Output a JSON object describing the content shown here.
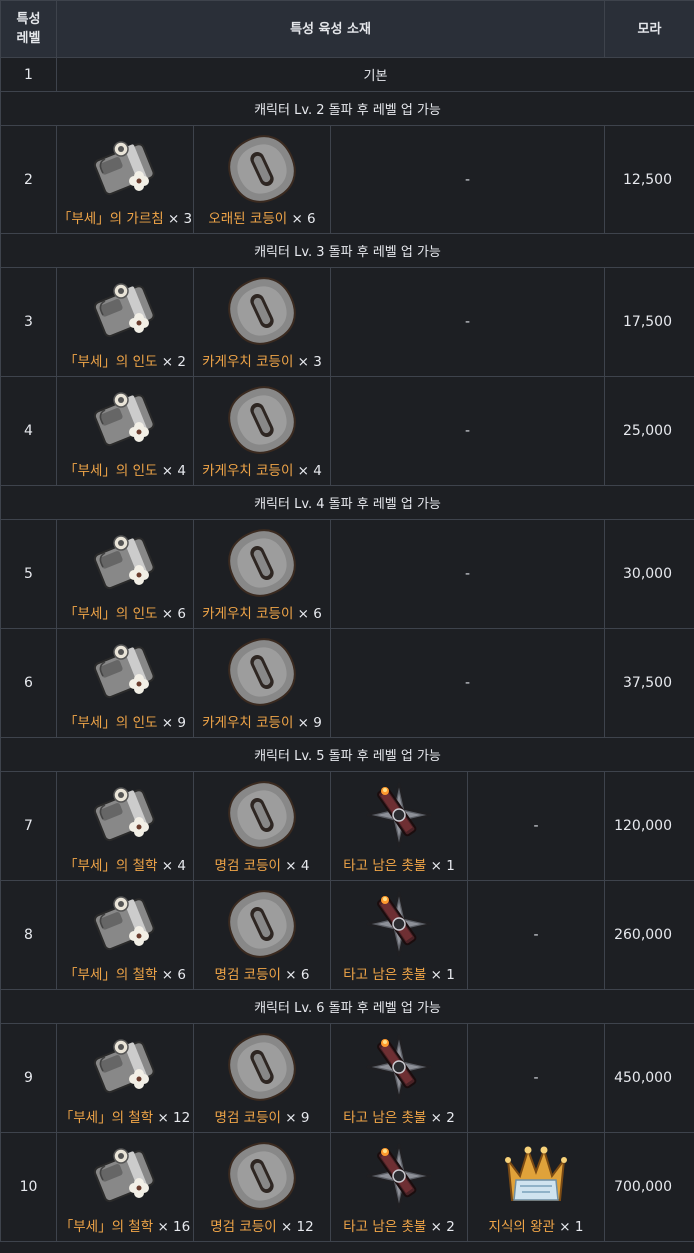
{
  "header": {
    "level_line1": "특성",
    "level_line2": "레벨",
    "materials": "특성 육성 소재",
    "mora": "모라"
  },
  "base": {
    "level": "1",
    "label": "기본"
  },
  "separators": [
    "캐릭터 Lv. 2 돌파 후 레벨 업 가능",
    "캐릭터 Lv. 3 돌파 후 레벨 업 가능",
    "캐릭터 Lv. 4 돌파 후 레벨 업 가능",
    "캐릭터 Lv. 5 돌파 후 레벨 업 가능",
    "캐릭터 Lv. 6 돌파 후 레벨 업 가능"
  ],
  "rows": [
    {
      "level": "2",
      "mora": "12,500",
      "dash": "-",
      "m1": {
        "icon": "book-bronze-icon",
        "name": "「부세」의 가르침",
        "qty": " × 3"
      },
      "m2": {
        "icon": "tsuba-bronze-icon",
        "name": "오래된 코등이",
        "qty": " × 6"
      }
    },
    {
      "level": "3",
      "mora": "17,500",
      "dash": "-",
      "m1": {
        "icon": "book-silver-icon",
        "name": "「부세」의 인도",
        "qty": " × 2"
      },
      "m2": {
        "icon": "tsuba-silver-icon",
        "name": "카게우치 코등이",
        "qty": " × 3"
      }
    },
    {
      "level": "4",
      "mora": "25,000",
      "dash": "-",
      "m1": {
        "icon": "book-silver-icon",
        "name": "「부세」의 인도",
        "qty": " × 4"
      },
      "m2": {
        "icon": "tsuba-silver-icon",
        "name": "카게우치 코등이",
        "qty": " × 4"
      }
    },
    {
      "level": "5",
      "mora": "30,000",
      "dash": "-",
      "m1": {
        "icon": "book-silver-icon",
        "name": "「부세」의 인도",
        "qty": " × 6"
      },
      "m2": {
        "icon": "tsuba-silver-icon",
        "name": "카게우치 코등이",
        "qty": " × 6"
      }
    },
    {
      "level": "6",
      "mora": "37,500",
      "dash": "-",
      "m1": {
        "icon": "book-silver-icon",
        "name": "「부세」의 인도",
        "qty": " × 9"
      },
      "m2": {
        "icon": "tsuba-silver-icon",
        "name": "카게우치 코등이",
        "qty": " × 9"
      }
    },
    {
      "level": "7",
      "mora": "120,000",
      "dash": "-",
      "m1": {
        "icon": "book-gold-icon",
        "name": "「부세」의 철학",
        "qty": " × 4"
      },
      "m2": {
        "icon": "tsuba-gold-icon",
        "name": "명검 코등이",
        "qty": " × 4"
      },
      "m3": {
        "icon": "burnt-candle-icon",
        "name": "타고 남은 촛불",
        "qty": " × 1"
      }
    },
    {
      "level": "8",
      "mora": "260,000",
      "dash": "-",
      "m1": {
        "icon": "book-gold-icon",
        "name": "「부세」의 철학",
        "qty": " × 6"
      },
      "m2": {
        "icon": "tsuba-gold-icon",
        "name": "명검 코등이",
        "qty": " × 6"
      },
      "m3": {
        "icon": "burnt-candle-icon",
        "name": "타고 남은 촛불",
        "qty": " × 1"
      }
    },
    {
      "level": "9",
      "mora": "450,000",
      "dash": "-",
      "m1": {
        "icon": "book-gold-icon",
        "name": "「부세」의 철학",
        "qty": " × 12"
      },
      "m2": {
        "icon": "tsuba-gold-icon",
        "name": "명검 코등이",
        "qty": " × 9"
      },
      "m3": {
        "icon": "burnt-candle-icon",
        "name": "타고 남은 촛불",
        "qty": " × 2"
      }
    },
    {
      "level": "10",
      "mora": "700,000",
      "m1": {
        "icon": "book-gold-icon",
        "name": "「부세」의 철학",
        "qty": " × 16"
      },
      "m2": {
        "icon": "tsuba-gold-icon",
        "name": "명검 코등이",
        "qty": " × 12"
      },
      "m3": {
        "icon": "burnt-candle-icon",
        "name": "타고 남은 촛불",
        "qty": " × 2"
      },
      "m4": {
        "icon": "crown-icon",
        "name": "지식의 왕관",
        "qty": " × 1"
      }
    }
  ],
  "colors": {
    "bg": "#1d1f23",
    "header_bg": "#2a2f38",
    "border": "#3e434c",
    "material_name": "#f0a548",
    "bronze": "#8a4a3a",
    "silver": "#8e9aa8",
    "gold": "#d6a431"
  }
}
